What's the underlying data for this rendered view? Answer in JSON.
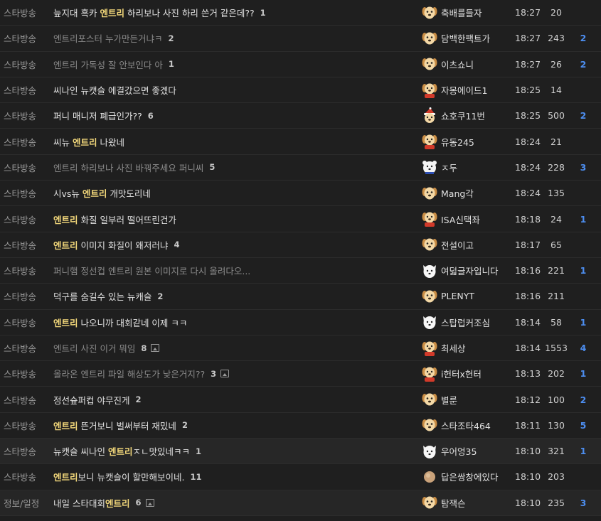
{
  "colors": {
    "keyword": "#f2d77a",
    "likes": "#4d8ef0",
    "background": "#1f1f1f"
  },
  "rows": [
    {
      "cat": "스타방송",
      "parts": [
        "늪지대 흑카 ",
        "엔트리",
        " 하리보나 사진 하리 쓴거 같은데??"
      ],
      "comments": "1",
      "dim": false,
      "img": false,
      "author": "축배를들자",
      "avatar": "puppy",
      "time": "18:27",
      "views": "20",
      "likes": ""
    },
    {
      "cat": "스타방송",
      "parts": [
        "엔트리포스터 누가만든거냐ㅋ"
      ],
      "comments": "2",
      "dim": true,
      "img": false,
      "author": "담백한팩트가",
      "avatar": "puppy",
      "time": "18:27",
      "views": "243",
      "likes": "2"
    },
    {
      "cat": "스타방송",
      "parts": [
        "엔트리 가독성 잘 안보인다 아"
      ],
      "comments": "1",
      "dim": true,
      "img": false,
      "author": "이츠쇼니",
      "avatar": "puppy",
      "time": "18:27",
      "views": "26",
      "likes": "2"
    },
    {
      "cat": "스타방송",
      "parts": [
        "씨나인 뉴캣슬 에결갔으면 좋겠다"
      ],
      "comments": "",
      "dim": false,
      "img": false,
      "author": "자몽에이드1",
      "avatar": "puppy-red",
      "time": "18:25",
      "views": "14",
      "likes": ""
    },
    {
      "cat": "스타방송",
      "parts": [
        "퍼니 매니저 폐급인가??"
      ],
      "comments": "6",
      "dim": false,
      "img": false,
      "author": "쇼호쿠11번",
      "avatar": "puppy-santa",
      "time": "18:25",
      "views": "500",
      "likes": "2"
    },
    {
      "cat": "스타방송",
      "parts": [
        "씨뉴 ",
        "엔트리",
        " 나왔네"
      ],
      "comments": "",
      "dim": false,
      "img": false,
      "author": "유동245",
      "avatar": "puppy-red",
      "time": "18:24",
      "views": "21",
      "likes": ""
    },
    {
      "cat": "스타방송",
      "parts": [
        "엔트리 하리보나 사진 바꿔주세요 퍼니씨"
      ],
      "comments": "5",
      "dim": true,
      "img": false,
      "author": "ㅈ두",
      "avatar": "bear",
      "time": "18:24",
      "views": "228",
      "likes": "3"
    },
    {
      "cat": "스타방송",
      "parts": [
        "시vs뉴 ",
        "엔트리",
        " 개맛도리네"
      ],
      "comments": "",
      "dim": false,
      "img": false,
      "author": "Mang각",
      "avatar": "puppy",
      "time": "18:24",
      "views": "135",
      "likes": ""
    },
    {
      "cat": "스타방송",
      "parts": [
        "",
        "엔트리",
        " 화질 일부러 떨어뜨린건가"
      ],
      "comments": "",
      "dim": false,
      "img": false,
      "author": "ISA신택좌",
      "avatar": "puppy-red",
      "time": "18:18",
      "views": "24",
      "likes": "1"
    },
    {
      "cat": "스타방송",
      "parts": [
        "",
        "엔트리",
        " 이미지 화질이 왜저러냐"
      ],
      "comments": "4",
      "dim": false,
      "img": false,
      "author": "전설이고",
      "avatar": "puppy",
      "time": "18:17",
      "views": "65",
      "likes": ""
    },
    {
      "cat": "스타방송",
      "parts": [
        "퍼니햄 정선컵 엔트리 원본 이미지로 다시 올려다오..."
      ],
      "comments": "",
      "dim": true,
      "img": false,
      "author": "여덟글자입니다",
      "avatar": "white-dog",
      "time": "18:16",
      "views": "221",
      "likes": "1"
    },
    {
      "cat": "스타방송",
      "parts": [
        "덕구를 숨길수 있는 뉴캐슬"
      ],
      "comments": "2",
      "dim": false,
      "img": false,
      "author": "PLENYT",
      "avatar": "puppy",
      "time": "18:16",
      "views": "211",
      "likes": ""
    },
    {
      "cat": "스타방송",
      "parts": [
        "",
        "엔트리",
        " 나오니까 대회같네 이제 ㅋㅋ"
      ],
      "comments": "",
      "dim": false,
      "img": false,
      "author": "스탑럽커조심",
      "avatar": "white-dog",
      "time": "18:14",
      "views": "58",
      "likes": "1"
    },
    {
      "cat": "스타방송",
      "parts": [
        "엔트리 사진 이거 뭐임"
      ],
      "comments": "8",
      "dim": true,
      "img": true,
      "author": "최세상",
      "avatar": "puppy-red",
      "time": "18:14",
      "views": "1553",
      "likes": "4"
    },
    {
      "cat": "스타방송",
      "parts": [
        "올라온 엔트리 파일 해상도가 낮은거지??"
      ],
      "comments": "3",
      "dim": true,
      "img": true,
      "author": "i헌터x헌터",
      "avatar": "puppy-red",
      "time": "18:13",
      "views": "202",
      "likes": "1"
    },
    {
      "cat": "스타방송",
      "parts": [
        "정선슢퍼컵 야무진게"
      ],
      "comments": "2",
      "dim": false,
      "img": false,
      "author": "별룬",
      "avatar": "puppy",
      "time": "18:12",
      "views": "100",
      "likes": "2"
    },
    {
      "cat": "스타방송",
      "parts": [
        "",
        "엔트리",
        " 뜬거보니 벌써부터 재밌네"
      ],
      "comments": "2",
      "dim": false,
      "img": false,
      "author": "스타조타464",
      "avatar": "puppy",
      "time": "18:11",
      "views": "130",
      "likes": "5"
    },
    {
      "cat": "스타방송",
      "parts": [
        "뉴캣슬 씨나인 ",
        "엔트리",
        "ㅈㄴ맛있네ㅋㅋ"
      ],
      "comments": "1",
      "dim": false,
      "img": false,
      "author": "우어엉35",
      "avatar": "white-dog",
      "time": "18:10",
      "views": "321",
      "likes": "1",
      "highlight": true
    },
    {
      "cat": "스타방송",
      "parts": [
        "",
        "엔트리",
        "보니 뉴캣슬이 할만해보이네."
      ],
      "comments": "11",
      "dim": false,
      "img": false,
      "author": "답은쌍창에있다",
      "avatar": "ball",
      "time": "18:10",
      "views": "203",
      "likes": ""
    },
    {
      "cat": "정보/일정",
      "parts": [
        "내일 스타대회",
        "엔트리",
        ""
      ],
      "comments": "6",
      "dim": false,
      "img": true,
      "author": "탐잭슨",
      "avatar": "puppy",
      "time": "18:10",
      "views": "235",
      "likes": "3"
    }
  ]
}
